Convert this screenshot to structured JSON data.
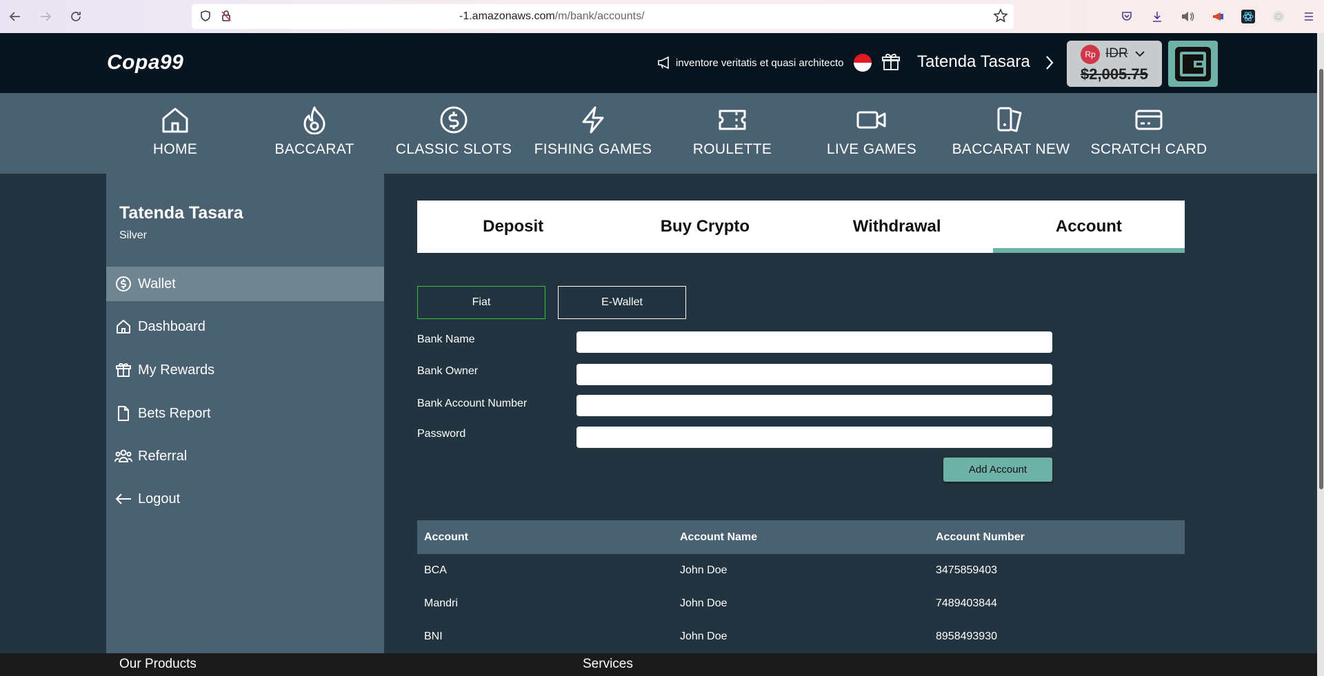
{
  "browser": {
    "url_host": "-1.amazonaws.com",
    "url_path": "/m/bank/accounts/"
  },
  "header": {
    "logo": "Copa99",
    "announcement": "inventore veritatis et quasi architecto",
    "user_name": "Tatenda Tasara",
    "currency_badge": "Rp",
    "currency": "IDR",
    "balance": "$2,005.75"
  },
  "categories": [
    {
      "label": "HOME",
      "icon": "home-icon"
    },
    {
      "label": "BACCARAT",
      "icon": "flame-icon"
    },
    {
      "label": "CLASSIC SLOTS",
      "icon": "dollar-coin-icon"
    },
    {
      "label": "FISHING GAMES",
      "icon": "lightning-icon"
    },
    {
      "label": "ROULETTE",
      "icon": "ticket-icon"
    },
    {
      "label": "LIVE GAMES",
      "icon": "video-icon"
    },
    {
      "label": "BACCARAT NEW",
      "icon": "cards-icon"
    },
    {
      "label": "SCRATCH CARD",
      "icon": "credit-card-icon"
    }
  ],
  "profile": {
    "name": "Tatenda Tasara",
    "tier": "Silver"
  },
  "sidebar": {
    "items": [
      {
        "label": "Wallet",
        "icon": "dollar-coin-icon",
        "active": true
      },
      {
        "label": "Dashboard",
        "icon": "home-icon"
      },
      {
        "label": "My Rewards",
        "icon": "gift-icon"
      },
      {
        "label": "Bets Report",
        "icon": "document-icon"
      },
      {
        "label": "Referral",
        "icon": "users-icon"
      },
      {
        "label": "Logout",
        "icon": "arrow-left-icon"
      }
    ]
  },
  "tabs": [
    {
      "label": "Deposit"
    },
    {
      "label": "Buy Crypto"
    },
    {
      "label": "Withdrawal"
    },
    {
      "label": "Account",
      "active": true
    }
  ],
  "sub_tabs": [
    {
      "label": "Fiat",
      "active": true
    },
    {
      "label": "E-Wallet"
    }
  ],
  "form": {
    "bank_name_label": "Bank Name",
    "bank_owner_label": "Bank Owner",
    "account_number_label": "Bank Account Number",
    "password_label": "Password",
    "bank_name_value": "",
    "bank_owner_value": "",
    "account_number_value": "",
    "password_value": "",
    "add_button": "Add Account"
  },
  "accounts_table": {
    "headers": [
      "Account",
      "Account Name",
      "Account Number"
    ],
    "rows": [
      [
        "BCA",
        "John Doe",
        "3475859403"
      ],
      [
        "Mandri",
        "John Doe",
        "7489403844"
      ],
      [
        "BNI",
        "John Doe",
        "8958493930"
      ]
    ]
  },
  "footer": {
    "products": "Our Products",
    "services": "Services"
  },
  "colors": {
    "accent": "#6eb2a7",
    "panel": "#4a6171",
    "background": "#22343f",
    "header": "#06151f",
    "active_subtab_border": "#3ac43a"
  }
}
